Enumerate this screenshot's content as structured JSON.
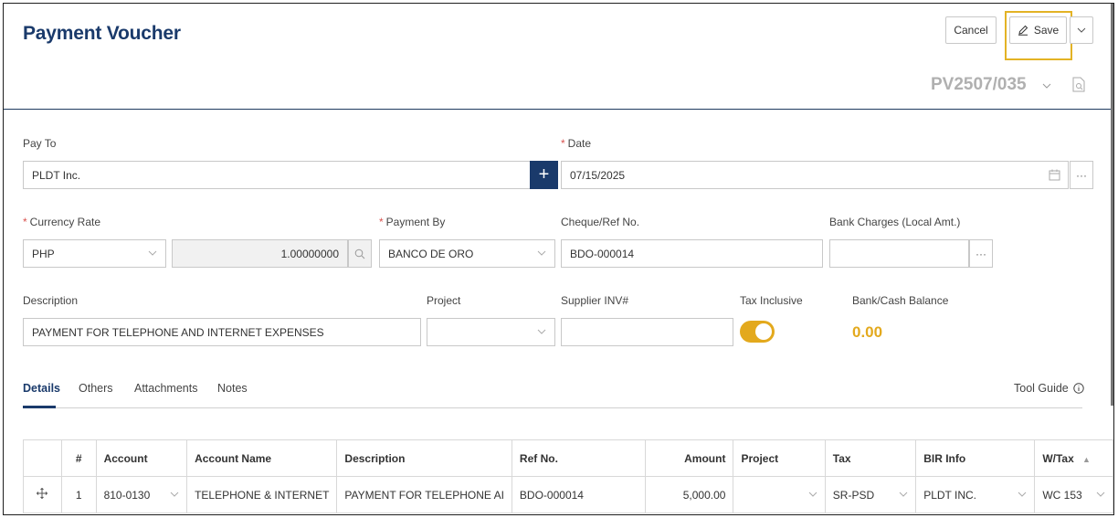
{
  "header": {
    "title": "Payment Voucher",
    "cancel_label": "Cancel",
    "save_label": "Save",
    "voucher_number": "PV2507/035"
  },
  "form": {
    "pay_to": {
      "label": "Pay To",
      "value": "PLDT Inc."
    },
    "date": {
      "label": "Date",
      "value": "07/15/2025"
    },
    "currency_rate": {
      "label": "Currency Rate",
      "currency": "PHP",
      "rate": "1.00000000"
    },
    "payment_by": {
      "label": "Payment By",
      "value": "BANCO DE ORO"
    },
    "cheque_ref": {
      "label": "Cheque/Ref No.",
      "value": "BDO-000014"
    },
    "bank_charges": {
      "label": "Bank Charges (Local Amt.)",
      "value": ""
    },
    "description": {
      "label": "Description",
      "value": "PAYMENT FOR TELEPHONE AND INTERNET EXPENSES"
    },
    "project": {
      "label": "Project",
      "value": ""
    },
    "supplier_inv": {
      "label": "Supplier INV#",
      "value": ""
    },
    "tax_inclusive": {
      "label": "Tax Inclusive",
      "on": true
    },
    "bank_balance": {
      "label": "Bank/Cash Balance",
      "value": "0.00"
    }
  },
  "tabs": [
    {
      "label": "Details",
      "active": true
    },
    {
      "label": "Others",
      "active": false
    },
    {
      "label": "Attachments",
      "active": false
    },
    {
      "label": "Notes",
      "active": false
    }
  ],
  "tool_guide_label": "Tool Guide",
  "table": {
    "headers": [
      "",
      "#",
      "Account",
      "Account Name",
      "Description",
      "Ref No.",
      "Amount",
      "Project",
      "Tax",
      "BIR Info",
      "W/Tax"
    ],
    "rows": [
      {
        "num": "1",
        "account": "810-0130",
        "account_name": "TELEPHONE & INTERNET",
        "description": "PAYMENT FOR TELEPHONE AI",
        "ref_no": "BDO-000014",
        "amount": "5,000.00",
        "project": "",
        "tax": "SR-PSD",
        "bir_info": "PLDT INC.",
        "wtax": "WC 153"
      }
    ]
  },
  "colors": {
    "brand": "#1a3a6b",
    "accent": "#e3a91d",
    "required": "#d9534f"
  }
}
